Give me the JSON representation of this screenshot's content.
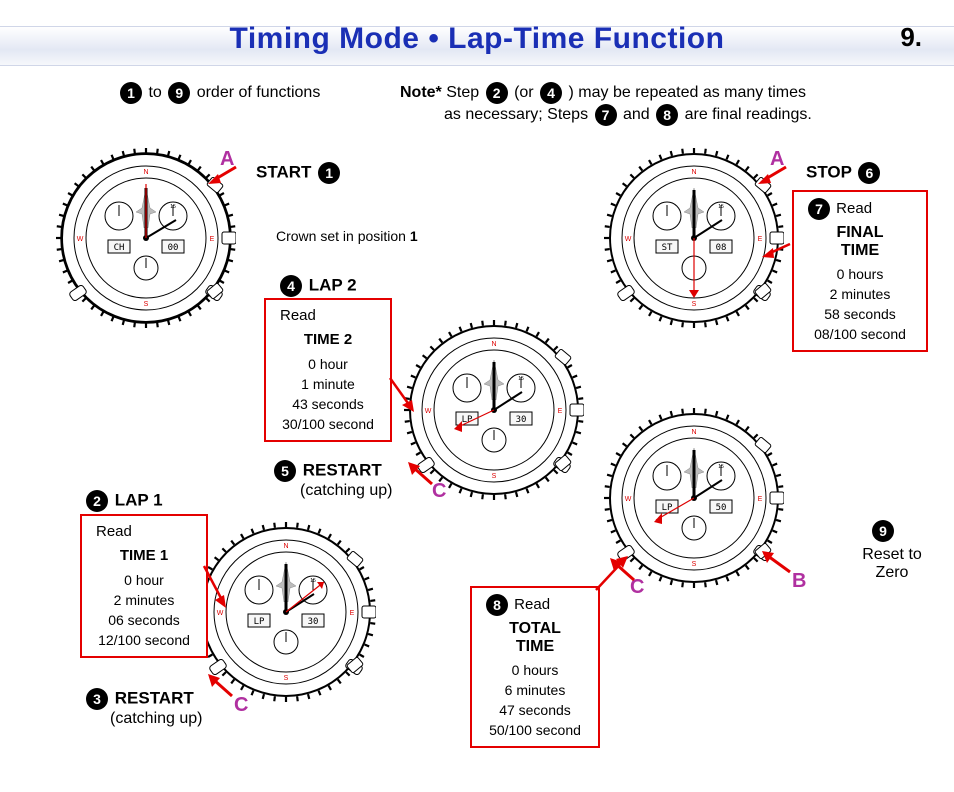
{
  "page": {
    "title": "Timing Mode • Lap-Time Function",
    "number": "9."
  },
  "intro": {
    "left_pre": "to",
    "left_post": "order of functions",
    "note_prefix": "Note*",
    "note_1a": "Step",
    "note_1b": "(or",
    "note_1c": ") may be repeated as many times",
    "note_2a": "as necessary; Steps",
    "note_2b": "and",
    "note_2c": "are final readings."
  },
  "steps": {
    "n1": "1",
    "n2": "2",
    "n3": "3",
    "n4": "4",
    "n5": "5",
    "n6": "6",
    "n7": "7",
    "n8": "8",
    "n9": "9"
  },
  "labels": {
    "start": "START",
    "stop": "STOP",
    "lap1_title": "LAP 1",
    "lap2_title": "LAP 2",
    "restart": "RESTART",
    "catching_up": "(catching up)",
    "read": "Read",
    "time1": "TIME 1",
    "time2": "TIME 2",
    "total_time": "TOTAL TIME",
    "final_time": "FINAL TIME",
    "reset_to_zero": "Reset to Zero",
    "reset_to": "Reset to",
    "zero": "Zero",
    "crown_note": "Crown set in position",
    "crown_pos": "1"
  },
  "pushers": {
    "A": "A",
    "B": "B",
    "C": "C"
  },
  "boxes": {
    "time1": {
      "l1": "0 hour",
      "l2": "2 minutes",
      "l3": "06 seconds",
      "l4": "12/100 second"
    },
    "time2": {
      "l1": "0 hour",
      "l2": "1 minute",
      "l3": "43 seconds",
      "l4": "30/100 second"
    },
    "total": {
      "l1": "0 hours",
      "l2": "6 minutes",
      "l3": "47 seconds",
      "l4": "50/100 second"
    },
    "final": {
      "l1": "0 hours",
      "l2": "2 minutes",
      "l3": "58 seconds",
      "l4": "08/100 second"
    }
  },
  "watches": {
    "w1_lcd": "CH",
    "w1_num": "00",
    "w2_lcd": "LP",
    "w2_num": "30",
    "w3_lcd": "LP",
    "w3_num": "30",
    "w4_lcd": "ST",
    "w4_num": "08",
    "w5_lcd": "LP",
    "w5_num": "50"
  }
}
